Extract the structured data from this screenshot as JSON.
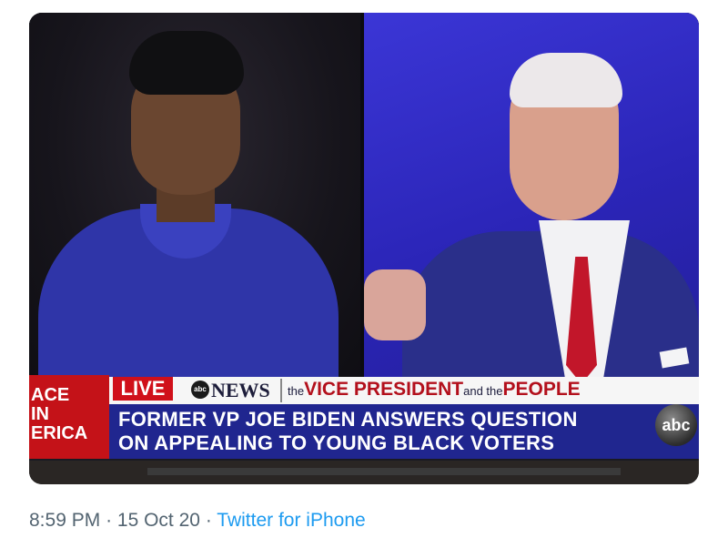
{
  "broadcast": {
    "side_label_lines": [
      "ACE",
      "IN",
      "ERICA"
    ],
    "live_label": "LIVE",
    "network_logo_text": "abc",
    "network_word": "NEWS",
    "show_title_prefix": "the",
    "show_title_main": "VICE PRESIDENT",
    "show_title_mid": "and the",
    "show_title_end": "PEOPLE",
    "headline_line1": "FORMER VP JOE BIDEN ANSWERS QUESTION",
    "headline_line2": "ON APPEALING TO YOUNG BLACK VOTERS",
    "corner_logo_text": "abc"
  },
  "tweet_meta": {
    "time": "8:59 PM",
    "separator1": "·",
    "date": "15 Oct 20",
    "separator2": "·",
    "source": "Twitter for iPhone"
  },
  "colors": {
    "live_red": "#d0101a",
    "headline_blue": "#20268f",
    "link_blue": "#1d9bf0",
    "meta_gray": "#536471"
  }
}
